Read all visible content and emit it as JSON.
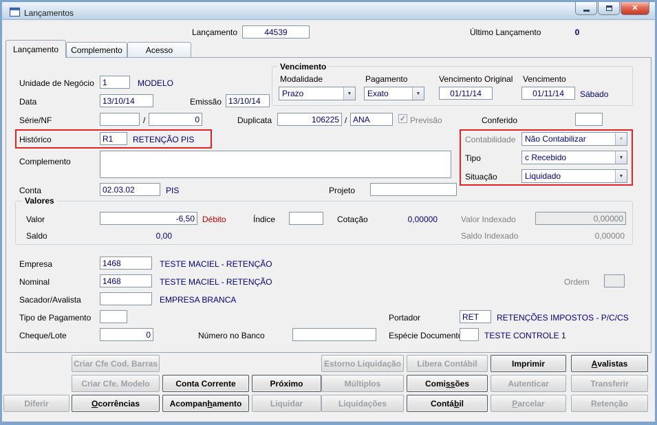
{
  "window": {
    "title": "Lançamentos"
  },
  "icons": {
    "dropdown": "▼",
    "check": "✓",
    "close": "✕"
  },
  "colors": {
    "value_text": "#000080",
    "negative_text": "#c00000",
    "highlight_border": "#e32222"
  },
  "header": {
    "lancamento_label": "Lançamento",
    "lancamento_value": "44539",
    "ultimo_lancamento_label": "Último Lançamento",
    "ultimo_lancamento_value": "0"
  },
  "tabs": [
    {
      "label": "Lançamento",
      "active": true
    },
    {
      "label": "Complemento",
      "active": false
    },
    {
      "label": "Acesso",
      "active": false
    }
  ],
  "form": {
    "unidade_negocio": {
      "label": "Unidade de Negócio",
      "value": "1",
      "desc": "MODELO"
    },
    "data": {
      "label": "Data",
      "value": "13/10/14"
    },
    "emissao": {
      "label": "Emissão",
      "value": "13/10/14"
    },
    "serie_nf": {
      "label": "Série/NF",
      "value1": "",
      "sep": "/",
      "value2": "0"
    },
    "duplicata": {
      "label": "Duplicata",
      "value1": "106225",
      "sep": "/",
      "value2": "ANA"
    },
    "previsao": {
      "label": "Previsão",
      "checked": true
    },
    "conferido": {
      "label": "Conferido",
      "value": ""
    },
    "historico": {
      "label": "Histórico",
      "value": "R1",
      "desc": "RETENÇÃO PIS"
    },
    "complemento": {
      "label": "Complemento",
      "value": ""
    },
    "conta": {
      "label": "Conta",
      "value": "02.03.02",
      "desc": "PIS"
    },
    "projeto": {
      "label": "Projeto",
      "value": ""
    },
    "vencimento_group": {
      "title": "Vencimento",
      "modalidade": {
        "label": "Modalidade",
        "value": "Prazo"
      },
      "pagamento": {
        "label": "Pagamento",
        "value": "Exato"
      },
      "vencimento_original": {
        "label": "Vencimento Original",
        "value": "01/11/14"
      },
      "vencimento": {
        "label": "Vencimento",
        "value": "01/11/14",
        "weekday": "Sábado"
      }
    },
    "contabilidade": {
      "label": "Contabilidade",
      "value": "Não Contabilizar"
    },
    "tipo": {
      "label": "Tipo",
      "value": "c Recebido"
    },
    "situacao": {
      "label": "Situação",
      "value": "Liquidado"
    },
    "valores_group": {
      "title": "Valores",
      "valor": {
        "label": "Valor",
        "value": "-6,50",
        "suffix": "Débito"
      },
      "indice": {
        "label": "Índice",
        "value": ""
      },
      "cotacao": {
        "label": "Cotação",
        "value": "0,00000"
      },
      "valor_indexado": {
        "label": "Valor Indexado",
        "value": "0,00000"
      },
      "saldo": {
        "label": "Saldo",
        "value": "0,00"
      },
      "saldo_indexado": {
        "label": "Saldo Indexado",
        "value": "0,00000"
      }
    },
    "empresa": {
      "label": "Empresa",
      "value": "1468",
      "desc": "TESTE MACIEL - RETENÇÃO"
    },
    "nominal": {
      "label": "Nominal",
      "value": "1468",
      "desc": "TESTE MACIEL - RETENÇÃO"
    },
    "ordem": {
      "label": "Ordem",
      "value": ""
    },
    "sacador_avalista": {
      "label": "Sacador/Avalista",
      "value": "",
      "desc": "EMPRESA BRANCA"
    },
    "tipo_pagamento": {
      "label": "Tipo de Pagamento",
      "value": ""
    },
    "portador": {
      "label": "Portador",
      "value": "RET",
      "desc": "RETENÇÕES IMPOSTOS - P/C/CS"
    },
    "cheque_lote": {
      "label": "Cheque/Lote",
      "value": "0"
    },
    "numero_banco": {
      "label": "Número no Banco",
      "value": ""
    },
    "especie_documento": {
      "label": "Espécie Documento",
      "value": "",
      "desc": "TESTE CONTROLE 1"
    }
  },
  "buttons": [
    {
      "id": "criar-cfe-cod-barras",
      "label": "Criar Cfe Cod. Barras",
      "row": 0,
      "col": 1,
      "enabled": false
    },
    {
      "id": "estorno-liquidacao",
      "label": "Estorno Liquidação",
      "row": 0,
      "col": 4,
      "enabled": false
    },
    {
      "id": "libera-contabil",
      "label": "Libera Contábil",
      "row": 0,
      "col": 5,
      "enabled": false
    },
    {
      "id": "imprimir",
      "label": "Imprimir",
      "row": 0,
      "col": 6,
      "enabled": true
    },
    {
      "id": "avalistas",
      "label": "Avalistas",
      "row": 0,
      "col": 7,
      "enabled": true,
      "u": "A"
    },
    {
      "id": "criar-cfe-modelo",
      "label": "Criar Cfe. Modelo",
      "row": 1,
      "col": 1,
      "enabled": false
    },
    {
      "id": "conta-corrente",
      "label": "Conta Corrente",
      "row": 1,
      "col": 2,
      "enabled": true
    },
    {
      "id": "proximo",
      "label": "Próximo",
      "row": 1,
      "col": 3,
      "enabled": true
    },
    {
      "id": "multiplos",
      "label": "Múltiplos",
      "row": 1,
      "col": 4,
      "enabled": false
    },
    {
      "id": "comissoes",
      "label": "Comissões",
      "row": 1,
      "col": 5,
      "enabled": true,
      "u": "ss"
    },
    {
      "id": "autenticar",
      "label": "Autenticar",
      "row": 1,
      "col": 6,
      "enabled": false
    },
    {
      "id": "transferir",
      "label": "Transferir",
      "row": 1,
      "col": 7,
      "enabled": false
    },
    {
      "id": "diferir",
      "label": "Diferir",
      "row": 2,
      "col": 0,
      "enabled": false
    },
    {
      "id": "ocorrencias",
      "label": "Ocorrências",
      "row": 2,
      "col": 1,
      "enabled": true,
      "u": "O"
    },
    {
      "id": "acompanhamento",
      "label": "Acompanhamento",
      "row": 2,
      "col": 2,
      "enabled": true,
      "u": "h"
    },
    {
      "id": "liquidar",
      "label": "Liquidar",
      "row": 2,
      "col": 3,
      "enabled": false
    },
    {
      "id": "liquidacoes",
      "label": "Liquidações",
      "row": 2,
      "col": 4,
      "enabled": false
    },
    {
      "id": "contabil",
      "label": "Contábil",
      "row": 2,
      "col": 5,
      "enabled": true,
      "u": "b"
    },
    {
      "id": "parcelar",
      "label": "Parcelar",
      "row": 2,
      "col": 6,
      "enabled": false,
      "u": "P"
    },
    {
      "id": "retencao",
      "label": "Retenção",
      "row": 2,
      "col": 7,
      "enabled": false
    }
  ]
}
